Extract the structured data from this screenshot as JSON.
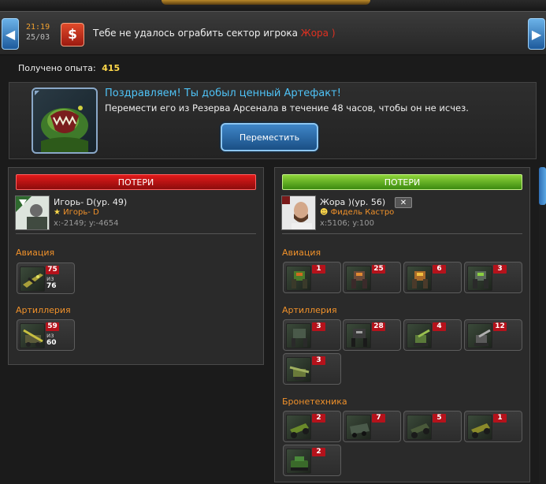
{
  "notification": {
    "time": "21:19",
    "date": "25/03",
    "message": "Тебе не удалось ограбить сектор игрока",
    "target_player": "Жора )"
  },
  "experience": {
    "label": "Получено опыта:",
    "value": "415"
  },
  "artifact": {
    "title": "Поздравляем! Ты добыл ценный Артефакт!",
    "text": "Перемести его из Резерва Арсенала в течение 48 часов, чтобы он не исчез.",
    "button": "Переместить"
  },
  "left": {
    "header": "ПОТЕРИ",
    "player": {
      "name": "Игорь- D(ур. 49)",
      "guild": "Игорь- D",
      "coords": "x:-2149; y:-4654"
    },
    "categories": [
      {
        "name": "Авиация",
        "units": [
          {
            "count": "75",
            "of": "из",
            "total": "76"
          }
        ]
      },
      {
        "name": "Артиллерия",
        "units": [
          {
            "count": "59",
            "of": "из",
            "total": "60"
          }
        ]
      }
    ]
  },
  "right": {
    "header": "ПОТЕРИ",
    "player": {
      "name": "Жора )(ур. 56)",
      "guild": "Фидель Кастро",
      "coords": "x:5106; y:100"
    },
    "categories": [
      {
        "name": "Авиация",
        "counts": [
          "1",
          "25",
          "6",
          "3"
        ]
      },
      {
        "name": "Артиллерия",
        "counts": [
          "3",
          "28",
          "4",
          "12",
          "3"
        ]
      },
      {
        "name": "Бронетехника",
        "counts": [
          "2",
          "7",
          "5",
          "1",
          "2"
        ]
      }
    ]
  },
  "colors": {
    "accent_blue": "#4fc3f7",
    "loss_red": "#e21a1a",
    "loss_green": "#8fd63a",
    "category_orange": "#f0912a"
  }
}
